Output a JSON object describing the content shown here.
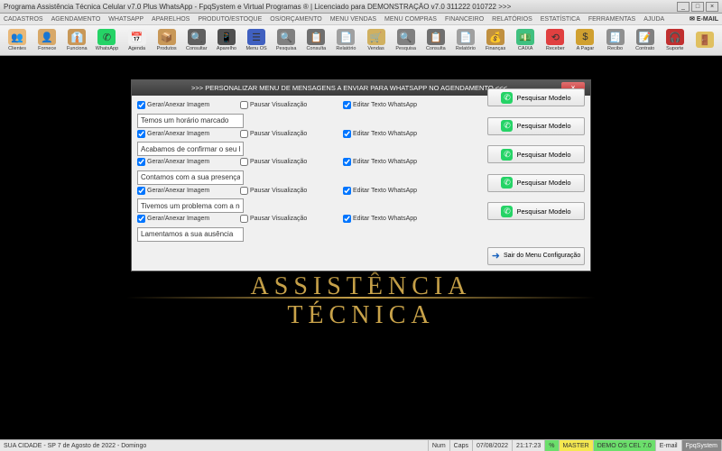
{
  "window": {
    "title": "Programa Assistência Técnica Celular v7.0 Plus WhatsApp - FpqSystem e Virtual Programas ® | Licenciado para  DEMONSTRAÇÃO v7.0 311222 010722 >>>"
  },
  "menu": {
    "items": [
      "CADASTROS",
      "AGENDAMENTO",
      "WHATSAPP",
      "APARELHOS",
      "PRODUTO/ESTOQUE",
      "OS/ORÇAMENTO",
      "MENU VENDAS",
      "MENU COMPRAS",
      "FINANCEIRO",
      "RELATÓRIOS",
      "ESTATÍSTICA",
      "FERRAMENTAS",
      "AJUDA"
    ],
    "email": "E-MAIL"
  },
  "toolbar": {
    "buttons": [
      {
        "label": "Clientes",
        "color": "#e8b878",
        "glyph": "👥"
      },
      {
        "label": "Fornece",
        "color": "#d8a868",
        "glyph": "👤"
      },
      {
        "label": "Funciona",
        "color": "#c89858",
        "glyph": "👔"
      },
      {
        "label": "WhatsApp",
        "color": "#25d366",
        "glyph": "✆"
      },
      {
        "label": "Agenda",
        "color": "#f0f0f0",
        "glyph": "📅"
      },
      {
        "label": "Produtos",
        "color": "#c89858",
        "glyph": "📦"
      },
      {
        "label": "Consultar",
        "color": "#606060",
        "glyph": "🔍"
      },
      {
        "label": "Aparelho",
        "color": "#505050",
        "glyph": "📱"
      },
      {
        "label": "Menu OS",
        "color": "#4060c0",
        "glyph": "☰"
      },
      {
        "label": "Pesquisa",
        "color": "#808080",
        "glyph": "🔍"
      },
      {
        "label": "Consulta",
        "color": "#707070",
        "glyph": "📋"
      },
      {
        "label": "Relatório",
        "color": "#a0a0a0",
        "glyph": "📄"
      },
      {
        "label": "Vendas",
        "color": "#d0b060",
        "glyph": "🛒"
      },
      {
        "label": "Pesquisa",
        "color": "#808080",
        "glyph": "🔍"
      },
      {
        "label": "Consulta",
        "color": "#707070",
        "glyph": "📋"
      },
      {
        "label": "Relatório",
        "color": "#a0a0a0",
        "glyph": "📄"
      },
      {
        "label": "Finanças",
        "color": "#c09040",
        "glyph": "💰"
      },
      {
        "label": "CAIXA",
        "color": "#40c080",
        "glyph": "💵"
      },
      {
        "label": "Receber",
        "color": "#e04040",
        "glyph": "⟲"
      },
      {
        "label": "A Pagar",
        "color": "#d0a030",
        "glyph": "$"
      },
      {
        "label": "Recibo",
        "color": "#909090",
        "glyph": "🧾"
      },
      {
        "label": "Contrato",
        "color": "#808080",
        "glyph": "📝"
      },
      {
        "label": "Suporte",
        "color": "#c03030",
        "glyph": "🎧"
      },
      {
        "label": "",
        "color": "#e0c060",
        "glyph": "🚪"
      }
    ]
  },
  "background": {
    "text": "ASSISTÊNCIA TÉCNICA"
  },
  "dialog": {
    "title": ">>> PERSONALIZAR MENU DE MENSAGENS A ENVIAR PARA WHATSAPP NO AGENDAMENTO <<<",
    "chk_gerar": "Gerar/Anexar Imagem",
    "chk_pausar": "Pausar Visualização",
    "chk_editar": "Editar Texto WhatsApp",
    "btn_pesquisar": "Pesquisar Modelo",
    "btn_sair": "Sair do Menu Configuração",
    "rows": [
      {
        "gerar": true,
        "pausar": false,
        "editar": true,
        "text": "Temos um horário marcado"
      },
      {
        "gerar": true,
        "pausar": false,
        "editar": true,
        "text": "Acabamos de confirmar o seu horário"
      },
      {
        "gerar": true,
        "pausar": false,
        "editar": true,
        "text": "Contamos com a sua presença!"
      },
      {
        "gerar": true,
        "pausar": false,
        "editar": true,
        "text": "Tivemos um problema com a nossa agenda."
      },
      {
        "gerar": true,
        "pausar": false,
        "editar": true,
        "text": "Lamentamos a sua ausência"
      }
    ]
  },
  "status": {
    "location": "SUA CIDADE - SP  7 de Agosto de 2022 - Domingo",
    "num": "Num",
    "caps": "Caps",
    "date": "07/08/2022",
    "time": "21:17:23",
    "pct": "%",
    "master": "MASTER",
    "db": "DEMO OS CEL 7.0",
    "email": "E-mail",
    "brand": "FpqSystem"
  }
}
